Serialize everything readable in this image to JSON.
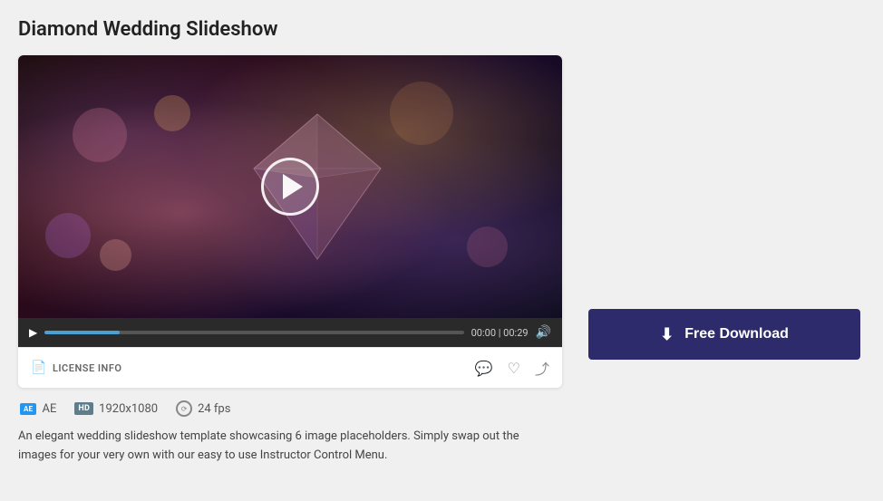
{
  "page": {
    "title": "Diamond Wedding Slideshow"
  },
  "video": {
    "duration": "00:29",
    "current_time": "00:00",
    "progress_percent": 18,
    "time_display": "00:00 | 00:29"
  },
  "license": {
    "label": "LICENSE INFO"
  },
  "meta": {
    "software": "AE",
    "resolution": "1920x1080",
    "fps": "24 fps"
  },
  "description": "An elegant wedding slideshow template showcasing 6 image placeholders. Simply swap out the images for your very own with our easy to use Instructor Control Menu.",
  "actions": {
    "download_label": "Free Download",
    "download_icon": "⬇"
  },
  "icons": {
    "play": "▶",
    "comment": "💬",
    "heart": "♡",
    "share": "⤴",
    "volume": "🔊",
    "license_doc": "📄"
  }
}
